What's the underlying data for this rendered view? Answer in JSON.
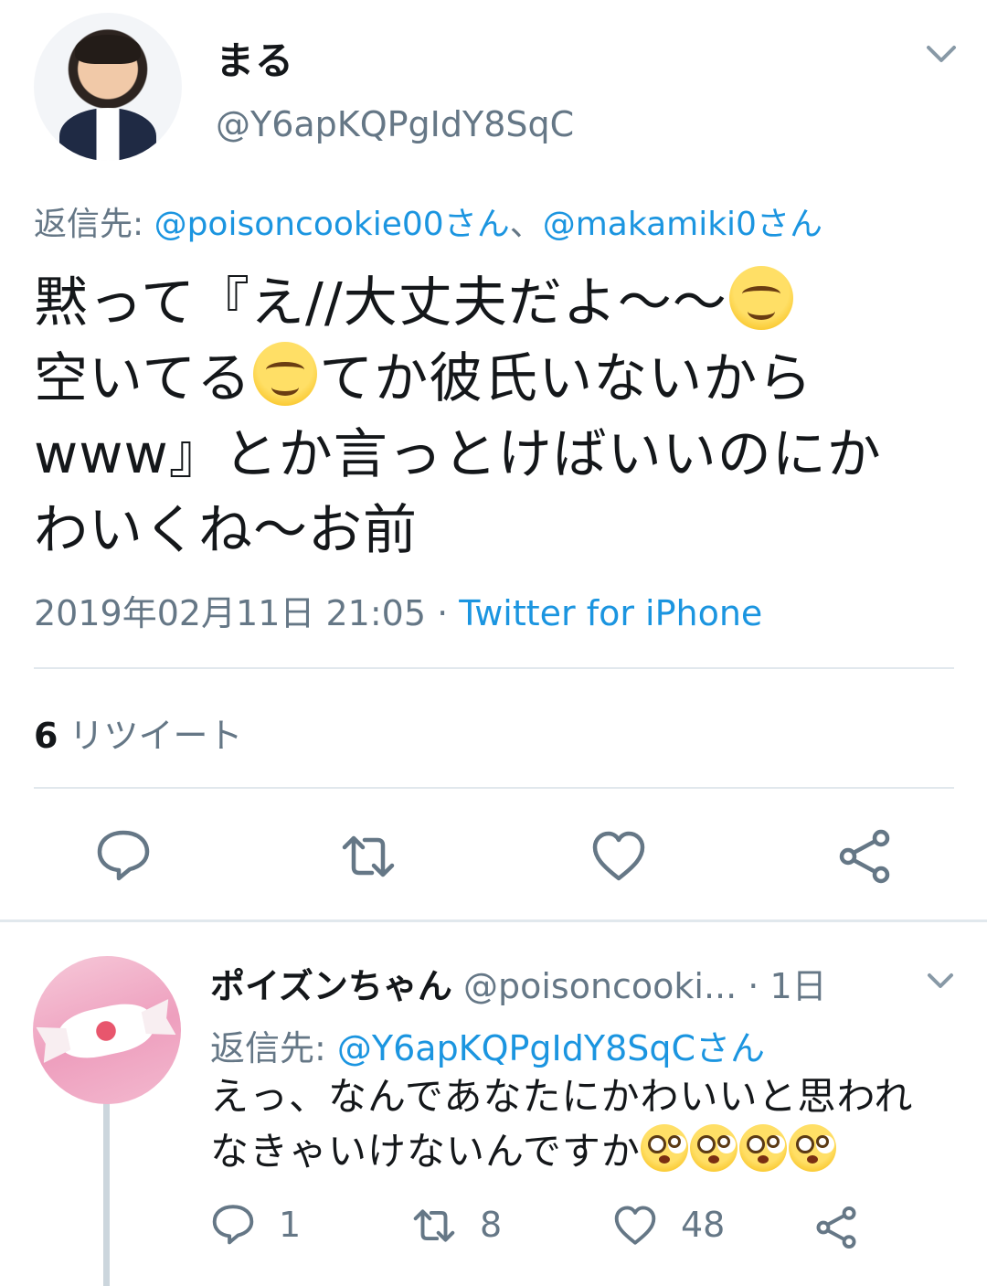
{
  "main_tweet": {
    "display_name": "まる",
    "handle": "@Y6apKQPgIdY8SqC",
    "reply_to_prefix": "返信先: ",
    "reply_to_1": "@poisoncookie00さん",
    "reply_to_sep": "、",
    "reply_to_2": "@makamiki0さん",
    "text_1": "黙って『え//大丈夫だよ〜〜",
    "text_2": "空いてる",
    "text_3": "てか彼氏いないから",
    "text_4": "www』とか言っとけばいいのにか",
    "text_5": "わいくね〜お前",
    "timestamp": "2019年02月11日 21:05",
    "meta_sep": " · ",
    "source": "Twitter for iPhone",
    "retweet_count": "6",
    "retweet_label": "リツイート",
    "icons": [
      "chevron-down-icon",
      "reply-icon",
      "retweet-icon",
      "like-icon",
      "share-icon",
      "smiling-face-emoji"
    ]
  },
  "reply_tweet": {
    "display_name": "ポイズンちゃん",
    "handle": "@poisoncooki...",
    "time_sep": " · ",
    "time": "1日",
    "reply_to_prefix": "返信先: ",
    "reply_to": "@Y6apKQPgIdY8SqCさん",
    "text_1": "えっ、なんであなたにかわいいと思われ",
    "text_2": "なきゃいけないんですか",
    "reply_count": "1",
    "retweet_count": "8",
    "like_count": "48",
    "icons": [
      "flushed-face-emoji",
      "reply-icon",
      "retweet-icon",
      "like-icon",
      "share-icon",
      "chevron-down-icon"
    ]
  },
  "colors": {
    "text": "#14171a",
    "secondary": "#657786",
    "link": "#1b95e0",
    "divider": "#e1e8ed"
  }
}
